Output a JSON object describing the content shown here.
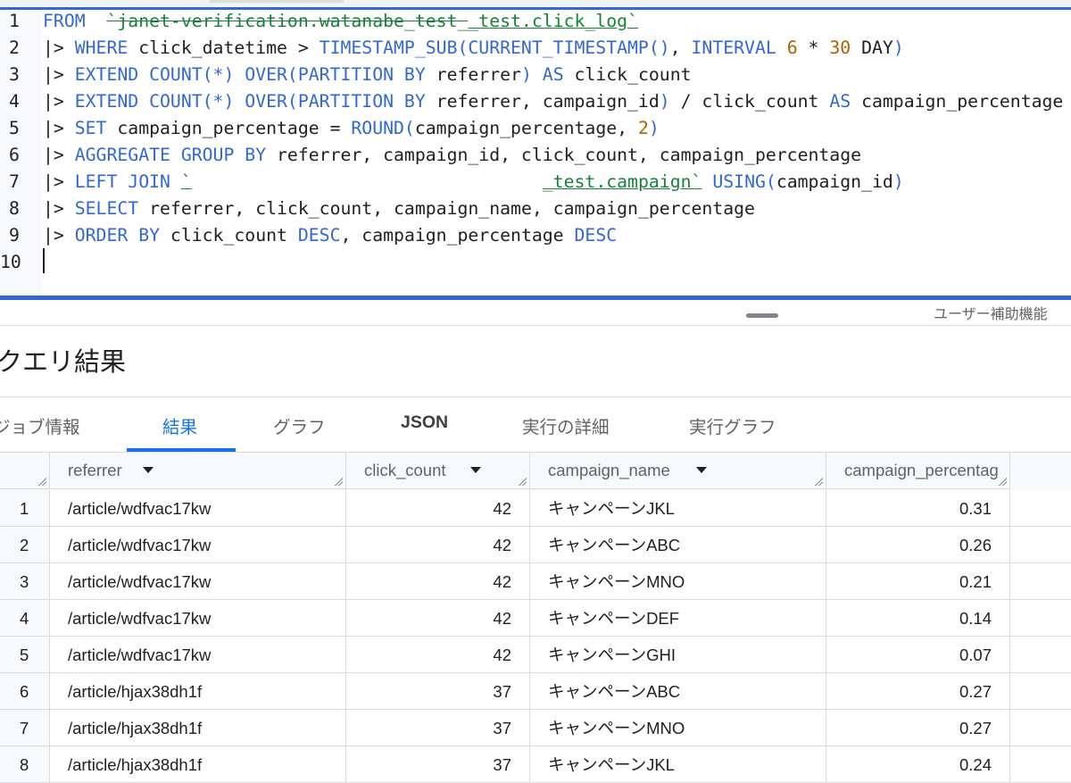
{
  "editor": {
    "lines": [
      {
        "num": "1",
        "parts": [
          [
            "kw",
            "FROM"
          ],
          [
            "",
            "  "
          ],
          [
            "tbl strike",
            "`janet-verification.watanabe_test_"
          ],
          [
            "tbl",
            "_test.click_log`"
          ]
        ]
      },
      {
        "num": "2",
        "parts": [
          [
            "",
            "|> "
          ],
          [
            "kw",
            "WHERE"
          ],
          [
            "",
            " click_datetime > "
          ],
          [
            "kw",
            "TIMESTAMP_SUB(CURRENT_TIMESTAMP()"
          ],
          [
            "",
            ", "
          ],
          [
            "kw",
            "INTERVAL"
          ],
          [
            "",
            " "
          ],
          [
            "num",
            "6"
          ],
          [
            "",
            " * "
          ],
          [
            "num",
            "30"
          ],
          [
            "",
            " DAY"
          ],
          [
            "kw",
            ")"
          ]
        ]
      },
      {
        "num": "3",
        "parts": [
          [
            "",
            "|> "
          ],
          [
            "kw",
            "EXTEND COUNT(*) OVER(PARTITION BY"
          ],
          [
            "",
            " referrer"
          ],
          [
            "kw",
            ")"
          ],
          [
            "",
            " "
          ],
          [
            "kw",
            "AS"
          ],
          [
            "",
            " click_count"
          ]
        ]
      },
      {
        "num": "4",
        "parts": [
          [
            "",
            "|> "
          ],
          [
            "kw",
            "EXTEND COUNT(*) OVER(PARTITION BY"
          ],
          [
            "",
            " referrer, campaign_id"
          ],
          [
            "kw",
            ")"
          ],
          [
            "",
            " / click_count "
          ],
          [
            "kw",
            "AS"
          ],
          [
            "",
            " campaign_percentage"
          ]
        ]
      },
      {
        "num": "5",
        "parts": [
          [
            "",
            "|> "
          ],
          [
            "kw",
            "SET"
          ],
          [
            "",
            " campaign_percentage = "
          ],
          [
            "kw",
            "ROUND("
          ],
          [
            "",
            "campaign_percentage, "
          ],
          [
            "num",
            "2"
          ],
          [
            "kw",
            ")"
          ]
        ]
      },
      {
        "num": "6",
        "parts": [
          [
            "",
            "|> "
          ],
          [
            "kw",
            "AGGREGATE GROUP BY"
          ],
          [
            "",
            " referrer, campaign_id, click_count, campaign_percentage"
          ]
        ]
      },
      {
        "num": "7",
        "parts": [
          [
            "",
            "|> "
          ],
          [
            "kw",
            "LEFT JOIN"
          ],
          [
            "",
            " "
          ],
          [
            "tbl",
            "`"
          ],
          [
            "gap",
            "                                 "
          ],
          [
            "tbl",
            "_test.campaign`"
          ],
          [
            "",
            " "
          ],
          [
            "kw",
            "USING("
          ],
          [
            "",
            "campaign_id"
          ],
          [
            "kw",
            ")"
          ]
        ]
      },
      {
        "num": "8",
        "parts": [
          [
            "",
            "|> "
          ],
          [
            "kw",
            "SELECT"
          ],
          [
            "",
            " referrer, click_count, campaign_name, campaign_percentage"
          ]
        ]
      },
      {
        "num": "9",
        "parts": [
          [
            "",
            "|> "
          ],
          [
            "kw",
            "ORDER BY"
          ],
          [
            "",
            " click_count "
          ],
          [
            "kw",
            "DESC"
          ],
          [
            "",
            ", campaign_percentage "
          ],
          [
            "kw",
            "DESC"
          ]
        ]
      },
      {
        "num": "10",
        "parts": []
      }
    ]
  },
  "accessibility_label": "ユーザー補助機能",
  "results": {
    "title": "クエリ結果",
    "tabs": [
      {
        "label": "ジョブ情報"
      },
      {
        "label": "結果"
      },
      {
        "label": "グラフ"
      },
      {
        "label": "JSON"
      },
      {
        "label": "実行の詳細"
      },
      {
        "label": "実行グラフ"
      }
    ],
    "active_tab": "結果",
    "columns": [
      "referrer",
      "click_count",
      "campaign_name",
      "campaign_percentag"
    ],
    "rows": [
      {
        "idx": "1",
        "referrer": "/article/wdfvac17kw",
        "click_count": "42",
        "campaign_name": "キャンペーンJKL",
        "campaign_percentage": "0.31"
      },
      {
        "idx": "2",
        "referrer": "/article/wdfvac17kw",
        "click_count": "42",
        "campaign_name": "キャンペーンABC",
        "campaign_percentage": "0.26"
      },
      {
        "idx": "3",
        "referrer": "/article/wdfvac17kw",
        "click_count": "42",
        "campaign_name": "キャンペーンMNO",
        "campaign_percentage": "0.21"
      },
      {
        "idx": "4",
        "referrer": "/article/wdfvac17kw",
        "click_count": "42",
        "campaign_name": "キャンペーンDEF",
        "campaign_percentage": "0.14"
      },
      {
        "idx": "5",
        "referrer": "/article/wdfvac17kw",
        "click_count": "42",
        "campaign_name": "キャンペーンGHI",
        "campaign_percentage": "0.07"
      },
      {
        "idx": "6",
        "referrer": "/article/hjax38dh1f",
        "click_count": "37",
        "campaign_name": "キャンペーンABC",
        "campaign_percentage": "0.27"
      },
      {
        "idx": "7",
        "referrer": "/article/hjax38dh1f",
        "click_count": "37",
        "campaign_name": "キャンペーンMNO",
        "campaign_percentage": "0.27"
      },
      {
        "idx": "8",
        "referrer": "/article/hjax38dh1f",
        "click_count": "37",
        "campaign_name": "キャンペーンJKL",
        "campaign_percentage": "0.24"
      }
    ]
  },
  "colors": {
    "accent": "#1a73e8",
    "editor_border": "#3367d6",
    "keyword": "#3367d6",
    "number": "#b06000",
    "table_ref": "#188038"
  }
}
